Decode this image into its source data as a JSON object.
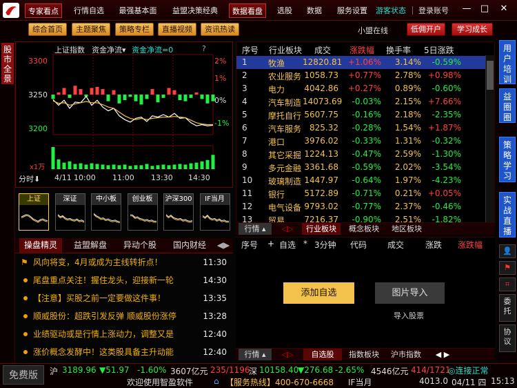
{
  "menu": {
    "items": [
      "专家看点",
      "行情自选",
      "最强基本面",
      "益盟决策经典",
      "数据看盘",
      "选股",
      "数据",
      "服务设置"
    ],
    "guest": "游客状态",
    "login": "登录账号"
  },
  "toolbar": {
    "items": [
      "综合首页",
      "主题聚焦",
      "策略专栏",
      "直播视频",
      "资讯热读"
    ],
    "league": "小盟在线",
    "open_account": "低佣开户",
    "grow": "学习成长"
  },
  "lefttab": {
    "label": "股市全景"
  },
  "chart": {
    "index_name": "上证指数",
    "fund_label": "资金净流▾",
    "fund_value": "资金净流=0",
    "help": "?",
    "period": "分时",
    "date": "4/11",
    "y_left": [
      "3300",
      "3250",
      "3200"
    ],
    "y_right": [
      "2%",
      "1%",
      "0%",
      "-1%"
    ],
    "x": [
      "10:00",
      "11:00",
      "13:30",
      "14:30"
    ],
    "volume_label": "x1万"
  },
  "chart_data": {
    "type": "line",
    "title": "上证指数",
    "x_ticks": [
      "10:00",
      "11:00",
      "13:30",
      "14:30"
    ],
    "ylim": [
      3189,
      3317
    ],
    "series": [
      {
        "name": "上证指数",
        "values": [
          3245,
          3236,
          3244,
          3231,
          3241,
          3240,
          3250,
          3236,
          3244,
          3233,
          3227,
          3231,
          3219,
          3213,
          3209,
          3215,
          3217,
          3210,
          3219,
          3217,
          3221,
          3217,
          3223,
          3215,
          3216,
          3208,
          3203,
          3205,
          3203,
          3204
        ]
      },
      {
        "name": "",
        "values": [
          3243,
          3239,
          3240,
          3236,
          3238,
          3240,
          3242,
          3240,
          3240,
          3237,
          3233,
          3231,
          3225,
          3219,
          3215,
          3213,
          3215,
          3213,
          3215,
          3216,
          3217,
          3217,
          3218,
          3217,
          3216,
          3212,
          3208,
          3206,
          3205,
          3205
        ]
      }
    ],
    "fund_flow": [
      -4,
      2,
      6,
      -3,
      8,
      5,
      -2,
      6,
      7,
      5,
      -6,
      4,
      -8,
      -5,
      -2,
      -6,
      -9,
      -4,
      5,
      -7,
      -3,
      6,
      4,
      -5,
      -6,
      -3,
      2,
      -4,
      -8,
      -6
    ],
    "volume": [
      34,
      15,
      10,
      12,
      8,
      9,
      7,
      9,
      8,
      7,
      6,
      7,
      6,
      7,
      5,
      6,
      6,
      8,
      5,
      6,
      7,
      6,
      7,
      8,
      7,
      9,
      10,
      12,
      14,
      22
    ]
  },
  "thumbs": [
    {
      "label": "上证",
      "active": true,
      "pts": [
        30,
        28,
        26,
        27,
        30,
        34,
        36,
        38,
        35,
        34,
        36,
        37
      ]
    },
    {
      "label": "深证",
      "active": false,
      "pts": [
        26,
        30,
        28,
        32,
        34,
        33,
        35,
        36,
        34,
        37,
        36,
        38
      ]
    },
    {
      "label": "中小板",
      "active": false,
      "pts": [
        24,
        28,
        30,
        33,
        32,
        35,
        34,
        36,
        37,
        36,
        38,
        39
      ]
    },
    {
      "label": "创业板",
      "active": false,
      "pts": [
        26,
        27,
        31,
        30,
        33,
        34,
        36,
        35,
        37,
        36,
        38,
        38
      ]
    },
    {
      "label": "沪深300",
      "active": false,
      "pts": [
        26,
        30,
        27,
        31,
        33,
        34,
        33,
        36,
        35,
        37,
        38,
        37
      ]
    },
    {
      "label": "IF当月",
      "active": false,
      "pts": [
        28,
        31,
        27,
        32,
        34,
        33,
        36,
        34,
        37,
        36,
        38,
        38
      ]
    }
  ],
  "news": {
    "tabs": [
      "操盘精灵",
      "益盟解盘",
      "异动个股",
      "国内财经"
    ],
    "rows": [
      {
        "text": "风向将变，4月或成为主线转折点！",
        "time": "11:30",
        "flag": true
      },
      {
        "text": "尾盘重点关注！握住龙头，迎接新一轮",
        "time": "14:30",
        "flag": false
      },
      {
        "text": "【注意】买股之前一定要做这件事！",
        "time": "13:35",
        "flag": false
      },
      {
        "text": "顺威股份：超跌引发反弹 顺威股份涨停",
        "time": "13:28",
        "flag": false
      },
      {
        "text": "业绩驱动或是行情上涨动力，调整又是",
        "time": "12:40",
        "flag": false
      },
      {
        "text": "涨价概念发酵中！这类股具备主升动能",
        "time": "12:40",
        "flag": false
      }
    ]
  },
  "table": {
    "headers": [
      "序号",
      "行业板块",
      "成交",
      "涨跌幅",
      "换手率",
      "5日涨跌"
    ],
    "rows": [
      [
        "1",
        "牧渔",
        "12820.81",
        "+1.06%",
        "3.14%",
        "-0.59%"
      ],
      [
        "2",
        "农业服务",
        "1058.73",
        "+0.77%",
        "2.78%",
        "+0.98%"
      ],
      [
        "3",
        "电力",
        "4042.86",
        "+0.27%",
        "0.89%",
        "-0.60%"
      ],
      [
        "4",
        "汽车制造",
        "14073.69",
        "-0.03%",
        "2.15%",
        "+7.66%"
      ],
      [
        "5",
        "摩托自行",
        "5607.75",
        "-0.16%",
        "2.18%",
        "-2.35%"
      ],
      [
        "6",
        "汽车服务",
        "825.32",
        "-0.28%",
        "1.54%",
        "+1.87%"
      ],
      [
        "7",
        "港口",
        "3976.02",
        "-0.33%",
        "1.31%",
        "-0.32%"
      ],
      [
        "8",
        "其它采掘",
        "1224.13",
        "-0.47%",
        "2.59%",
        "-1.30%"
      ],
      [
        "9",
        "多元金融",
        "3361.68",
        "-0.59%",
        "2.02%",
        "-3.54%"
      ],
      [
        "10",
        "玻璃制造",
        "1447.97",
        "-0.64%",
        "1.97%",
        "-4.23%"
      ],
      [
        "11",
        "银行",
        "5172.89",
        "-0.71%",
        "0.21%",
        "+0.05%"
      ],
      [
        "12",
        "电气设备",
        "9793.02",
        "-0.77%",
        "2.37%",
        "-0.46%"
      ],
      [
        "13",
        "贸易",
        "7216.37",
        "-0.90%",
        "2.51%",
        "-1.82%"
      ]
    ],
    "bottom_tabs": [
      "行情",
      "行业板块",
      "概念板块",
      "地区板块"
    ]
  },
  "watch": {
    "headers": [
      "序号",
      "自选",
      "3分钟",
      "代码",
      "成交",
      "涨跌",
      "涨跌幅"
    ],
    "add": "添加自选",
    "img_import": "图片导入",
    "import_stock": "导入股票",
    "bottom_tabs": [
      "行情",
      "自选股",
      "指数板块",
      "沪市指数"
    ]
  },
  "right": {
    "tabs": [
      "用户培训",
      "益圈圈",
      "策略学习",
      "实战直播"
    ],
    "tools": [
      "委托",
      "协议"
    ]
  },
  "status": {
    "free": "免费版",
    "sh_label": "沪",
    "sh_value": "3189.96",
    "sh_change": "▼51.97",
    "sh_pct": "-1.60%",
    "sh_amount": "3607亿元",
    "sh_updown": "235/1196",
    "sz_label": "深",
    "sz_value": "10158.40",
    "sz_change": "▼276.68",
    "sz_pct": "-2.65%",
    "sz_amount": "4546亿元",
    "sz_updown": "414/1721",
    "conn": "连接正常",
    "welcome": "欢迎使用智盈软件",
    "hotline": "【服务热线】400-670-6668",
    "if_label": "IF当月",
    "if_value": "4013.0",
    "date": "04/11 四",
    "time": "15:13"
  },
  "colors": {
    "up": "#ff4040",
    "down": "#22ee44",
    "accent": "#f2c24a",
    "blue": "#1f55c9"
  }
}
